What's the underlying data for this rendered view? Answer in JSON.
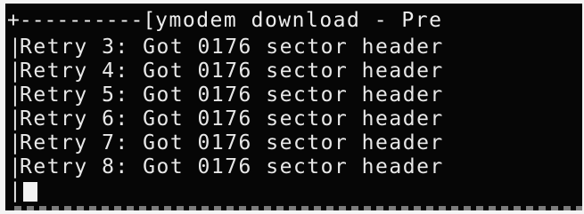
{
  "terminal": {
    "header": {
      "left_border": "+----------[",
      "title": "ymodem download - Pre"
    },
    "border_char": "|",
    "lines": [
      "Retry 3: Got 0176 sector header",
      "Retry 4: Got 0176 sector header",
      "Retry 5: Got 0176 sector header",
      "Retry 6: Got 0176 sector header",
      "Retry 7: Got 0176 sector header",
      "Retry 8: Got 0176 sector header"
    ],
    "colors": {
      "background": "#060606",
      "text": "#e8e8e8"
    }
  }
}
